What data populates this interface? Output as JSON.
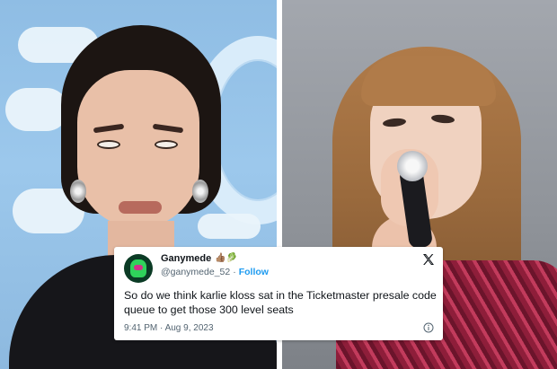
{
  "tweet": {
    "display_name": "Ganymede",
    "emojis": "👍🏽🥬",
    "handle": "@ganymede_52",
    "separator": "·",
    "follow_label": "Follow",
    "text": "So do we think karlie kloss sat in the Ticketmaster presale code queue to get those 300 level seats",
    "timestamp": "9:41 PM · Aug 9, 2023",
    "icons": {
      "avatar": "green-creature-avatar",
      "platform": "x-logo-icon",
      "info": "info-icon"
    }
  },
  "photos": {
    "left": "woman-dark-hair-portrait",
    "right": "woman-singing-microphone"
  },
  "colors": {
    "link": "#1d9bf0",
    "text": "#0f1419",
    "muted": "#536471"
  }
}
